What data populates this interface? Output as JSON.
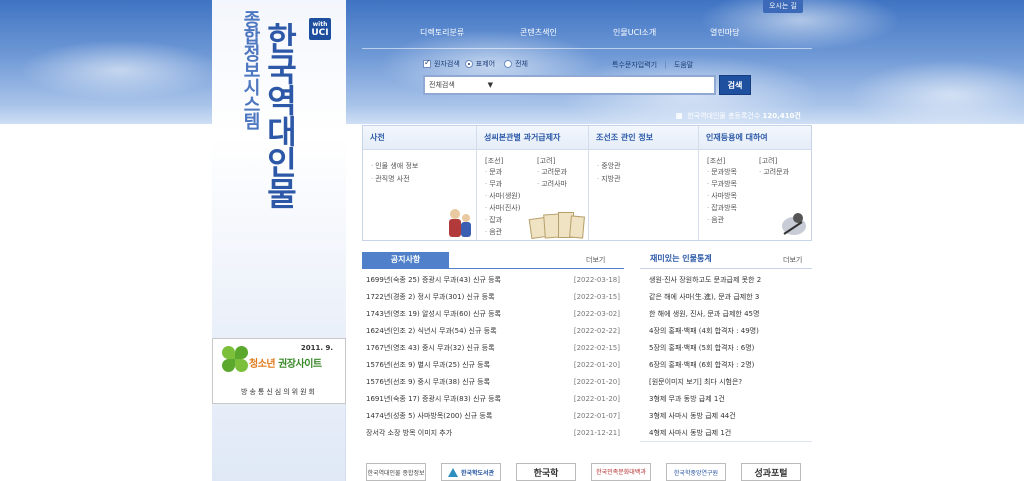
{
  "header": {
    "location_button": "오시는 길",
    "nav": [
      "디렉토리분류",
      "콘텐츠색인",
      "인물UCI소개",
      "열린마당"
    ],
    "uci_badge": {
      "with": "with",
      "uci": "UCI"
    }
  },
  "logo": {
    "main_title": "한국역대인물",
    "sub_title": "종합정보시스템"
  },
  "search": {
    "options": [
      {
        "label": "원자검색",
        "type": "checkbox",
        "checked": true
      },
      {
        "label": "표제어",
        "type": "radio",
        "checked": true
      },
      {
        "label": "전체",
        "type": "radio",
        "checked": false
      }
    ],
    "links": [
      "특수문자입력기",
      "도움말"
    ],
    "scope_select": "전체검색",
    "button_label": "검색",
    "total_label": "한국역대인물 총등록건수",
    "total_count": "120,410건"
  },
  "panels": [
    {
      "title": "사전",
      "items": [
        "인물 생애 정보",
        "관직명 사전"
      ]
    },
    {
      "title": "성씨본관별 과거급제자",
      "col1_head": "[조선]",
      "col1": [
        "문과",
        "무과",
        "사마(생원)",
        "사마(진사)",
        "잡과",
        "음관"
      ],
      "col2_head": "[고려]",
      "col2": [
        "고려문과",
        "고려사마"
      ]
    },
    {
      "title": "조선조 관인 정보",
      "items": [
        "중앙관",
        "지방관"
      ]
    },
    {
      "title": "인재등용에 대하여",
      "col1_head": "[조선]",
      "col1": [
        "문과방목",
        "무과방목",
        "사마방목",
        "잡과방목",
        "음관"
      ],
      "col2_head": "[고려]",
      "col2": [
        "고려문과"
      ]
    }
  ],
  "notice": {
    "tab_label": "공지사항",
    "more": "더보기",
    "rows": [
      {
        "title": "1699년(숙종 25) 증광시 무과(43) 신규 등록",
        "date": "[2022-03-18]"
      },
      {
        "title": "1722년(경종 2) 정시 무과(301) 신규 등록",
        "date": "[2022-03-15]"
      },
      {
        "title": "1743년(영조 19) 알성시 무과(60) 신규 등록",
        "date": "[2022-03-02]"
      },
      {
        "title": "1624년(인조 2) 식년시 무과(54) 신규 등록",
        "date": "[2022-02-22]"
      },
      {
        "title": "1767년(영조 43) 중시 무과(32) 신규 등록",
        "date": "[2022-02-15]"
      },
      {
        "title": "1576년(선조 9) 별시 무과(25) 신규 등록",
        "date": "[2022-01-20]"
      },
      {
        "title": "1576년(선조 9) 중시 무과(38) 신규 등록",
        "date": "[2022-01-20]"
      },
      {
        "title": "1691년(숙종 17) 증광시 무과(83) 신규 등록",
        "date": "[2022-01-20]"
      },
      {
        "title": "1474년(성종 5) 사마방목(200) 신규 등록",
        "date": "[2022-01-07]"
      },
      {
        "title": "장서각 소장 방목 이미지 추가",
        "date": "[2021-12-21]"
      }
    ]
  },
  "stats": {
    "title": "재미있는 인물통계",
    "more": "더보기",
    "rows": [
      "생원·진사 장원하고도 문과급제 못한 2",
      "같은 해에 사마(生.進), 문과 급제한 3",
      "한 해에 생원, 진사, 문과 급제한 45명",
      "4장의 홍패·백패 (4회 합격자 : 49명)",
      "5장의 홍패·백패 (5회 합격자 : 6명)",
      "6장의 홍패·백패 (6회 합격자 : 2명)",
      "[원문이미지 보기] 최다 시험은?",
      "3형제 무과 동방 급제 1건",
      "3형제 사마시 동방 급제 44건",
      "4형제 사마시 동방 급제 1건"
    ]
  },
  "award": {
    "date": "2011. 9.",
    "title_a": "청소년",
    "title_b": "권장사이트",
    "org": "방송통신심의위원회"
  },
  "banners": [
    "한국역대인물 종합정보",
    "한국학도서관",
    "한국학",
    "한국민족문화대백과",
    "한국학중앙연구원",
    "성과포털"
  ],
  "colors": {
    "accent": "#1f4f9f",
    "panel_title": "#2d5aa8",
    "notice_tab": "#4f80c9"
  }
}
